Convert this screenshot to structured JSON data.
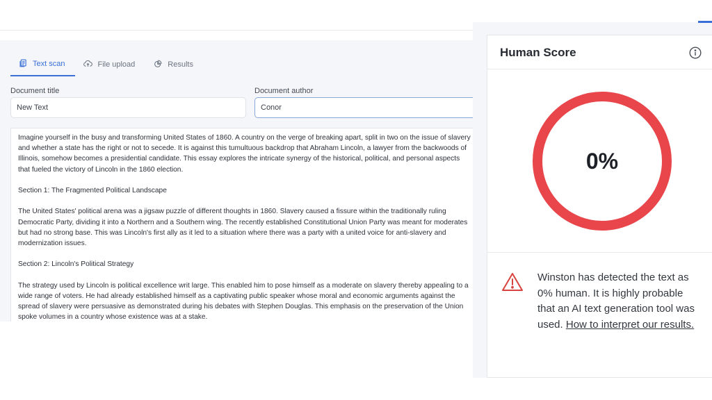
{
  "tabs": [
    {
      "label": "Text scan",
      "icon": "document-icon",
      "active": true
    },
    {
      "label": "File upload",
      "icon": "cloud-upload-icon",
      "active": false
    },
    {
      "label": "Results",
      "icon": "pie-chart-icon",
      "active": false
    }
  ],
  "form": {
    "title_label": "Document title",
    "title_value": "New Text",
    "author_label": "Document author",
    "author_value": "Conor"
  },
  "document": {
    "paragraphs": [
      "Imagine yourself in the busy and transforming United States of 1860. A country on the verge of breaking apart, split in two on the issue of slavery and whether a state has the right or not to secede. It is against this tumultuous backdrop that Abraham Lincoln, a lawyer from the backwoods of Illinois, somehow becomes a presidential candidate. This essay explores the intricate synergy of the historical, political, and personal aspects that fueled the victory of Lincoln in the 1860 election.",
      "Section 1: The Fragmented Political Landscape",
      "The United States' political arena was a jigsaw puzzle of different thoughts in 1860. Slavery caused a fissure within the traditionally ruling Democratic Party, dividing it into a Northern and a Southern wing. The recently established Constitutional Union Party was meant for moderates but had no strong base. This was Lincoln's first ally as it led to a situation where there was a party with a united voice for anti-slavery and modernization issues.",
      "Section 2: Lincoln's Political Strategy",
      "The strategy used by Lincoln is political excellence writ large. This enabled him to pose himself as a moderate on slavery thereby appealing to a wide range of voters. He had already established himself as a captivating public speaker whose moral and economic arguments against the spread of slavery were persuasive as demonstrated during his debates with Stephen Douglas. This emphasis on the preservation of the Union spoke volumes in a country whose existence was at a stake."
    ]
  },
  "score_panel": {
    "title": "Human Score",
    "info_icon": "info-icon",
    "score_percent": 0,
    "score_label": "0%",
    "ring_color": "#e8464a",
    "warning_icon": "warning-triangle-icon",
    "warning_color": "#d9433f",
    "verdict_text": "Winston has detected the text as 0% human. It is highly probable that an AI text generation tool was used.",
    "link_text": "How to interpret our results."
  },
  "colors": {
    "accent": "#3a6fd8",
    "panel_bg": "#f4f6f9"
  }
}
